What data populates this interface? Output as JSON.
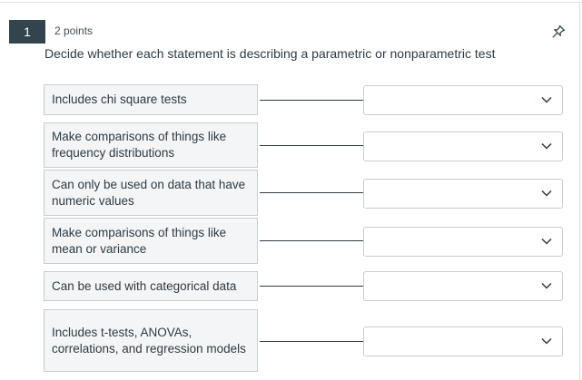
{
  "question": {
    "number": "1",
    "points": "2 points",
    "prompt": "Decide whether each statement is describing a parametric or nonparametric test"
  },
  "matches": [
    {
      "statement": "Includes chi square tests",
      "selected": ""
    },
    {
      "statement": "Make comparisons of things like frequency distributions",
      "selected": ""
    },
    {
      "statement": "Can only be used on data that have numeric values",
      "selected": ""
    },
    {
      "statement": "Make comparisons of things like mean or variance",
      "selected": ""
    },
    {
      "statement": "Can be used with categorical data",
      "selected": ""
    },
    {
      "statement": "Includes t-tests, ANOVAs, correlations, and regression models",
      "selected": ""
    }
  ],
  "icons": {
    "pin": "pin-icon",
    "chevron": "chevron-down-icon"
  },
  "colors": {
    "badge_bg": "#34444f",
    "statement_bg": "#f4f5f6",
    "border": "#c7cdd1",
    "text": "#2d3b45"
  }
}
